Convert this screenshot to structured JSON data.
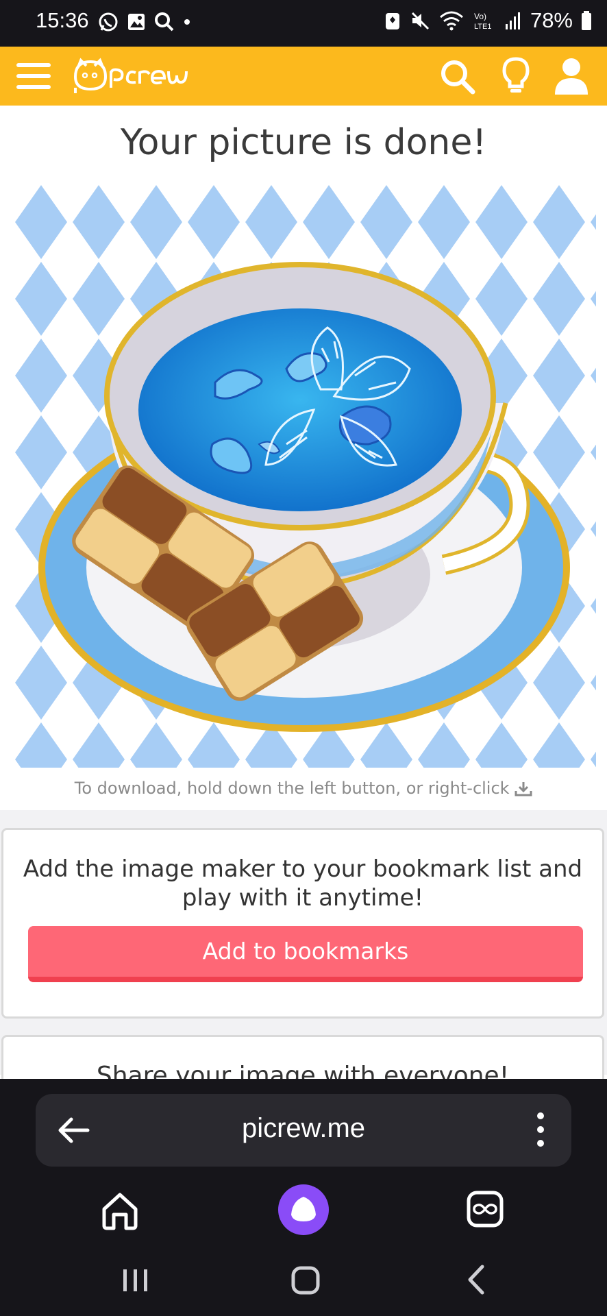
{
  "status_bar": {
    "time": "15:36",
    "left_icons": [
      "whatsapp-icon",
      "gallery-icon",
      "search-icon",
      "dot-icon"
    ],
    "right_icons": [
      "battery-saver-icon",
      "mute-icon",
      "wifi-icon",
      "volte-icon",
      "signal-icon"
    ],
    "volte_label": "Vo)\nLTE1",
    "battery": "78%"
  },
  "app_bar": {
    "logo_text": "Picrew",
    "icons": [
      "menu-icon",
      "search-icon",
      "lightbulb-icon",
      "user-icon"
    ],
    "color": "#fcb91d"
  },
  "main": {
    "title": "Your picture is done!",
    "picture_alt": "teacup with blue tea, butterfly and checkered cookies on argyle background",
    "download_hint": "To download, hold down the left button, or right-click"
  },
  "bookmark_card": {
    "message": "Add the image maker to your bookmark list and play with it anytime!",
    "button_label": "Add to bookmarks",
    "button_color": "#fe6776"
  },
  "share_card": {
    "message": "Share your image with everyone!"
  },
  "browser": {
    "url": "picrew.me",
    "icons": [
      "back-arrow-icon",
      "more-vert-icon",
      "home-icon",
      "assistant-icon",
      "tabs-icon"
    ]
  },
  "system_nav": {
    "icons": [
      "recents-icon",
      "home-button-icon",
      "back-icon"
    ]
  }
}
